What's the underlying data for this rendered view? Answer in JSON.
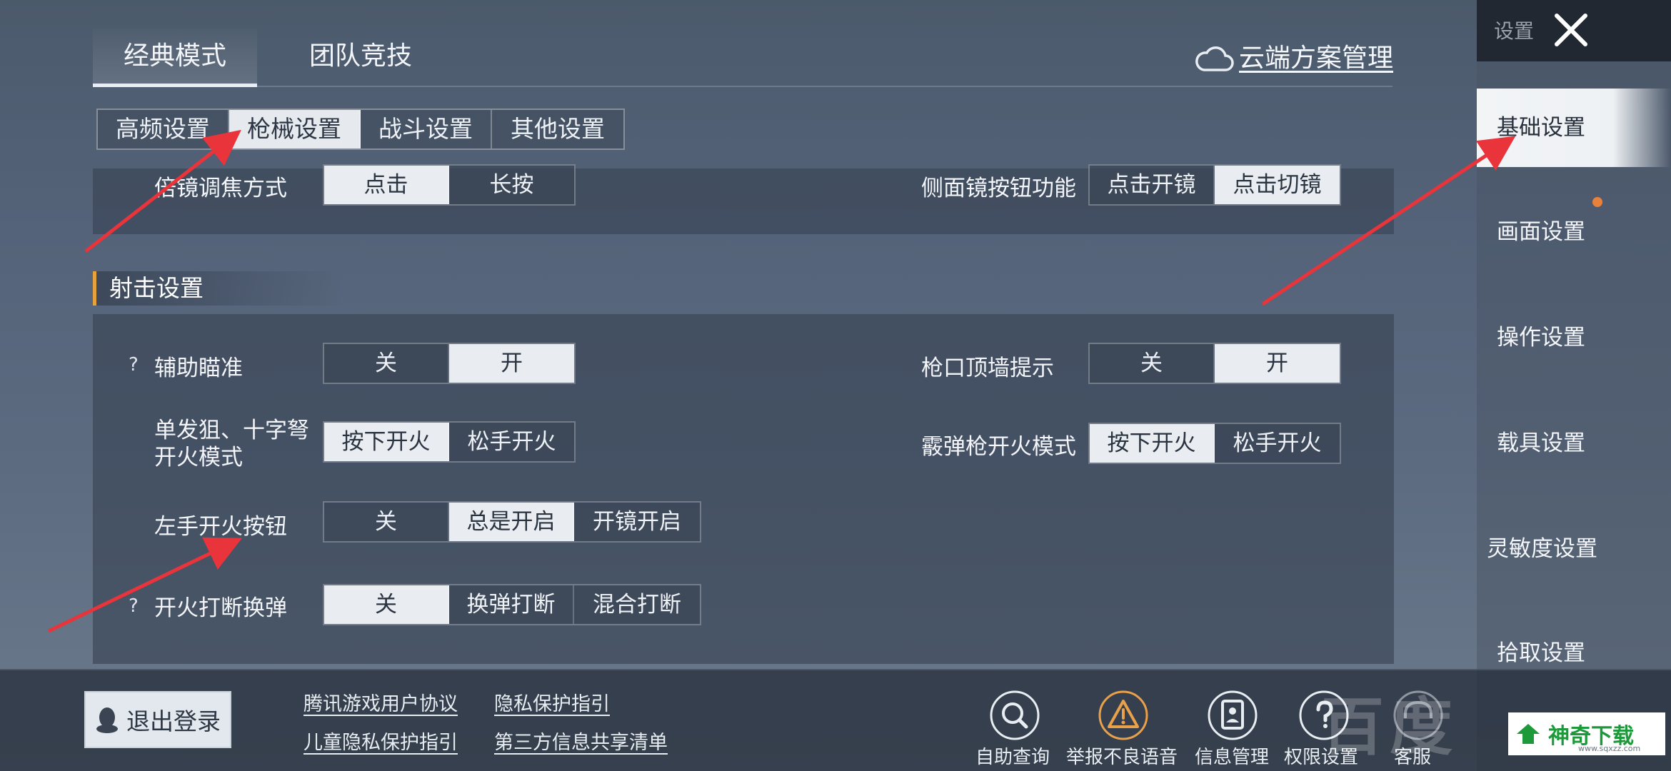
{
  "mode_tabs": [
    {
      "label": "经典模式",
      "active": true
    },
    {
      "label": "团队竞技",
      "active": false
    }
  ],
  "cloud": {
    "label": "云端方案管理",
    "icon": "cloud-icon"
  },
  "sub_tabs": [
    {
      "label": "高频设置",
      "active": false
    },
    {
      "label": "枪械设置",
      "active": true
    },
    {
      "label": "战斗设置",
      "active": false
    },
    {
      "label": "其他设置",
      "active": false
    }
  ],
  "scope_row": {
    "left": {
      "label": "倍镜调焦方式",
      "options": [
        "点击",
        "长按"
      ],
      "selected": 0
    },
    "right": {
      "label": "侧面镜按钮功能",
      "options": [
        "点击开镜",
        "点击切镜"
      ],
      "selected": 1
    }
  },
  "shooting": {
    "title": "射击设置",
    "help_mark": "?",
    "aim_assist": {
      "label": "辅助瞄准",
      "options": [
        "关",
        "开"
      ],
      "selected": 1
    },
    "muzzle_wall": {
      "label": "枪口顶墙提示",
      "options": [
        "关",
        "开"
      ],
      "selected": 1
    },
    "sniper_fire": {
      "label_line1": "单发狙、十字弩",
      "label_line2": "开火模式",
      "options": [
        "按下开火",
        "松手开火"
      ],
      "selected": 0
    },
    "shotgun_fire": {
      "label": "霰弹枪开火模式",
      "options": [
        "按下开火",
        "松手开火"
      ],
      "selected": 0
    },
    "left_fire": {
      "label": "左手开火按钮",
      "options": [
        "关",
        "总是开启",
        "开镜开启"
      ],
      "selected": 1
    },
    "fire_interrupt": {
      "label": "开火打断换弹",
      "options": [
        "关",
        "换弹打断",
        "混合打断"
      ],
      "selected": 0
    }
  },
  "sidebar": {
    "title": "设置",
    "close_icon": "close-icon",
    "items": [
      {
        "label": "基础设置",
        "active": true
      },
      {
        "label": "画面设置",
        "active": false
      },
      {
        "label": "操作设置",
        "active": false
      },
      {
        "label": "载具设置",
        "active": false
      },
      {
        "label": "灵敏度设置",
        "active": false
      },
      {
        "label": "拾取设置",
        "active": false
      }
    ],
    "badge_color": "#e8823a"
  },
  "bottom": {
    "logout": "退出登录",
    "links": [
      "腾讯游戏用户协议",
      "隐私保护指引",
      "儿童隐私保护指引",
      "第三方信息共享清单"
    ],
    "icons": [
      {
        "label": "自助查询",
        "icon": "search-icon"
      },
      {
        "label": "举报不良语音",
        "icon": "warning-icon"
      },
      {
        "label": "信息管理",
        "icon": "id-card-icon"
      },
      {
        "label": "权限设置",
        "icon": "question-icon"
      },
      {
        "label": "客服",
        "icon": "headset-icon"
      }
    ]
  },
  "watermark": {
    "text": "百度",
    "brand": "神奇下载",
    "brand_url": "www.sqxzz.com"
  },
  "colors": {
    "accent": "#e6a23c",
    "annotation": "#e8343a",
    "selected_bg": "#e9edf1"
  }
}
